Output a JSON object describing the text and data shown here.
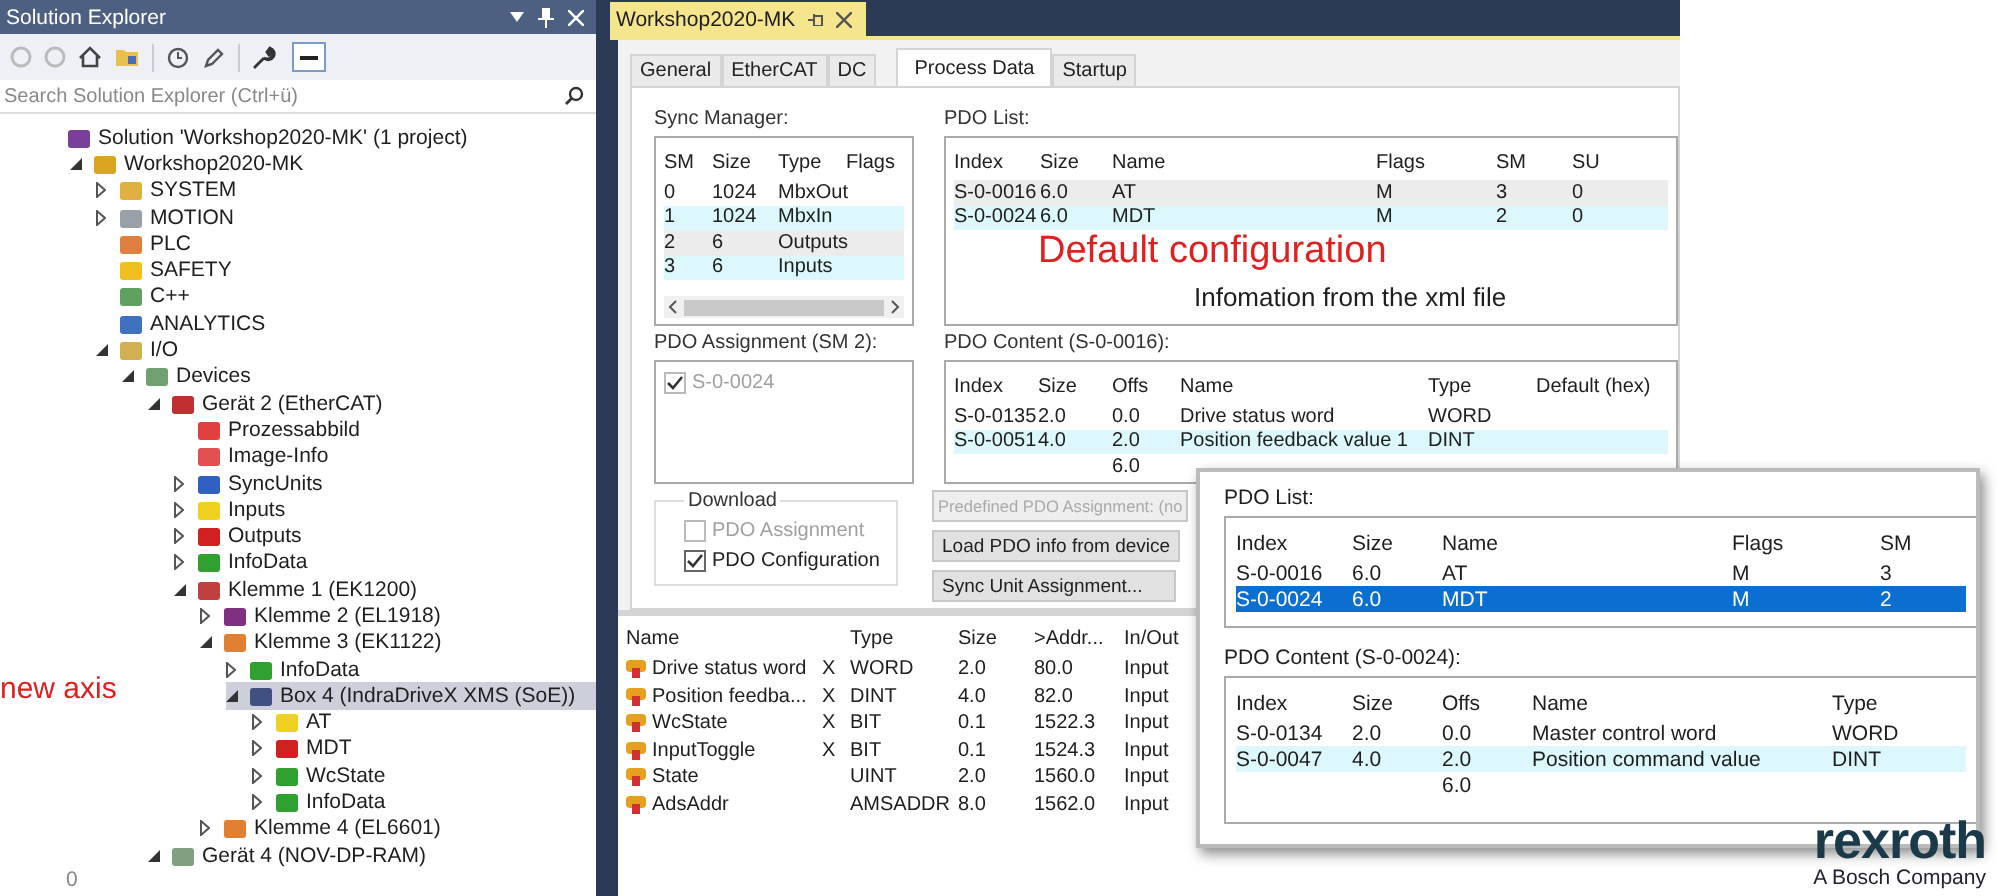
{
  "solution_explorer": {
    "title": "Solution Explorer",
    "search": {
      "placeholder": "Search Solution Explorer (Ctrl+ü)"
    },
    "tree": [
      {
        "label": "Solution 'Workshop2020-MK' (1 project)",
        "color": "#7a3f9a",
        "selected": false,
        "children": [
          {
            "label": "Workshop2020-MK",
            "color": "#d9a520",
            "expanded": true,
            "selected": false,
            "children": [
              {
                "label": "SYSTEM",
                "color": "#e0b040",
                "expanded": false,
                "selected": false
              },
              {
                "label": "MOTION",
                "color": "#9aa0a8",
                "expanded": false,
                "selected": false
              },
              {
                "label": "PLC",
                "color": "#e08040",
                "selected": false
              },
              {
                "label": "SAFETY",
                "color": "#f0c020",
                "selected": false
              },
              {
                "label": "C++",
                "color": "#60a060",
                "selected": false
              },
              {
                "label": "ANALYTICS",
                "color": "#4070c0",
                "selected": false
              },
              {
                "label": "I/O",
                "color": "#d0b050",
                "expanded": true,
                "selected": false,
                "children": [
                  {
                    "label": "Devices",
                    "color": "#70a070",
                    "expanded": true,
                    "selected": false,
                    "children": [
                      {
                        "label": "Gerät 2 (EtherCAT)",
                        "color": "#c03030",
                        "expanded": true,
                        "selected": false,
                        "children": [
                          {
                            "label": "Prozessabbild",
                            "color": "#e04040",
                            "selected": false
                          },
                          {
                            "label": "Image-Info",
                            "color": "#e05050",
                            "selected": false
                          },
                          {
                            "label": "SyncUnits",
                            "color": "#3060c0",
                            "expanded": false,
                            "selected": false
                          },
                          {
                            "label": "Inputs",
                            "color": "#f0d020",
                            "expanded": false,
                            "selected": false
                          },
                          {
                            "label": "Outputs",
                            "color": "#d02020",
                            "expanded": false,
                            "selected": false
                          },
                          {
                            "label": "InfoData",
                            "color": "#30a030",
                            "expanded": false,
                            "selected": false
                          },
                          {
                            "label": "Klemme 1 (EK1200)",
                            "color": "#c04040",
                            "expanded": true,
                            "selected": false,
                            "children": [
                              {
                                "label": "Klemme 2 (EL1918)",
                                "color": "#803080",
                                "expanded": false,
                                "selected": false
                              },
                              {
                                "label": "Klemme 3 (EK1122)",
                                "color": "#e08030",
                                "expanded": true,
                                "selected": false,
                                "children": [
                                  {
                                    "label": "InfoData",
                                    "color": "#30a030",
                                    "expanded": false,
                                    "selected": false
                                  },
                                  {
                                    "label": "Box 4 (IndraDriveX XMS (SoE))",
                                    "color": "#405080",
                                    "expanded": true,
                                    "selected": true,
                                    "children": [
                                      {
                                        "label": "AT",
                                        "color": "#f0d020",
                                        "expanded": false,
                                        "selected": false
                                      },
                                      {
                                        "label": "MDT",
                                        "color": "#d02020",
                                        "expanded": false,
                                        "selected": false
                                      },
                                      {
                                        "label": "WcState",
                                        "color": "#30a030",
                                        "expanded": false,
                                        "selected": false
                                      },
                                      {
                                        "label": "InfoData",
                                        "color": "#30a030",
                                        "expanded": false,
                                        "selected": false
                                      }
                                    ]
                                  }
                                ]
                              },
                              {
                                "label": "Klemme 4 (EL6601)",
                                "color": "#e08030",
                                "expanded": false,
                                "selected": false
                              }
                            ]
                          }
                        ]
                      },
                      {
                        "label": "Gerät 4 (NOV-DP-RAM)",
                        "color": "#80a080",
                        "expanded": true,
                        "selected": false
                      }
                    ]
                  }
                ]
              }
            ]
          }
        ]
      }
    ]
  },
  "annotation": "new axis",
  "status_bar": {
    "text": "0"
  },
  "document_tab": {
    "title": "Workshop2020-MK"
  },
  "tabs": [
    {
      "label": "General",
      "selected": false
    },
    {
      "label": "EtherCAT",
      "selected": false
    },
    {
      "label": "DC",
      "selected": false
    },
    {
      "label": "Process Data",
      "selected": true
    },
    {
      "label": "Startup",
      "selected": false
    }
  ],
  "sync_manager": {
    "label": "Sync Manager:",
    "columns": [
      "SM",
      "Size",
      "Type",
      "Flags"
    ],
    "rows": [
      {
        "sm": "0",
        "size": "1024",
        "type": "MbxOut"
      },
      {
        "sm": "1",
        "size": "1024",
        "type": "MbxIn",
        "color": "#ddf8fc"
      },
      {
        "sm": "2",
        "size": "6",
        "type": "Outputs",
        "color": "#ececec"
      },
      {
        "sm": "3",
        "size": "6",
        "type": "Inputs",
        "color": "#ddf8fc"
      }
    ]
  },
  "pdo_list": {
    "label": "PDO List:",
    "columns": [
      "Index",
      "Size",
      "Name",
      "Flags",
      "SM",
      "SU"
    ],
    "rows": [
      {
        "index": "S-0-0016",
        "size": "6.0",
        "name": "AT",
        "flags": "M",
        "sm": "3",
        "su": "0",
        "color": "#ececec"
      },
      {
        "index": "S-0-0024",
        "size": "6.0",
        "name": "MDT",
        "flags": "M",
        "sm": "2",
        "su": "0",
        "color": "#ddf8fc"
      }
    ],
    "overlay_title": "Default configuration",
    "overlay_note": "Infomation from the xml file"
  },
  "pdo_assignment": {
    "label": "PDO Assignment (SM 2):",
    "items": [
      {
        "label": "S-0-0024",
        "checked": true,
        "disabled": true
      }
    ]
  },
  "pdo_content": {
    "label": "PDO Content (S-0-0016):",
    "columns": [
      "Index",
      "Size",
      "Offs",
      "Name",
      "Type",
      "Default (hex)"
    ],
    "rows": [
      {
        "index": "S-0-0135",
        "size": "2.0",
        "offs": "0.0",
        "name": "Drive status word",
        "type": "WORD"
      },
      {
        "index": "S-0-0051",
        "size": "4.0",
        "offs": "2.0",
        "name": "Position feedback value 1",
        "type": "DINT",
        "color": "#ddf8fc"
      },
      {
        "offs": "6.0"
      }
    ]
  },
  "download": {
    "label": "Download",
    "options": [
      {
        "label": "PDO Assignment",
        "checked": false,
        "disabled": true
      },
      {
        "label": "PDO Configuration",
        "checked": true,
        "disabled": false
      }
    ]
  },
  "buttons": [
    {
      "label": "Predefined PDO Assignment: (no",
      "disabled": true
    },
    {
      "label": "Load PDO info from device",
      "disabled": false
    },
    {
      "label": "Sync Unit Assignment...",
      "disabled": false
    }
  ],
  "variables": {
    "columns": [
      "Name",
      "Type",
      "Size",
      ">Addr...",
      "In/Out"
    ],
    "rows": [
      {
        "name": "Drive status word",
        "x": "X",
        "type": "WORD",
        "size": "2.0",
        "addr": "80.0",
        "inout": "Input"
      },
      {
        "name": "Position feedba...",
        "x": "X",
        "type": "DINT",
        "size": "4.0",
        "addr": "82.0",
        "inout": "Input"
      },
      {
        "name": "WcState",
        "x": "X",
        "type": "BIT",
        "size": "0.1",
        "addr": "1522.3",
        "inout": "Input"
      },
      {
        "name": "InputToggle",
        "x": "X",
        "type": "BIT",
        "size": "0.1",
        "addr": "1524.3",
        "inout": "Input"
      },
      {
        "name": "State",
        "type": "UINT",
        "size": "2.0",
        "addr": "1560.0",
        "inout": "Input"
      },
      {
        "name": "AdsAddr",
        "type": "AMSADDR",
        "size": "8.0",
        "addr": "1562.0",
        "inout": "Input"
      }
    ]
  },
  "callout": {
    "pdo_list": {
      "label": "PDO List:",
      "columns": [
        "Index",
        "Size",
        "Name",
        "Flags",
        "SM"
      ],
      "rows": [
        {
          "index": "S-0-0016",
          "size": "6.0",
          "name": "AT",
          "flags": "M",
          "sm": "3",
          "selected": false
        },
        {
          "index": "S-0-0024",
          "size": "6.0",
          "name": "MDT",
          "flags": "M",
          "sm": "2",
          "selected": true
        }
      ]
    },
    "pdo_content": {
      "label": "PDO Content (S-0-0024):",
      "columns": [
        "Index",
        "Size",
        "Offs",
        "Name",
        "Type"
      ],
      "rows": [
        {
          "index": "S-0-0134",
          "size": "2.0",
          "offs": "0.0",
          "name": "Master control word",
          "type": "WORD"
        },
        {
          "index": "S-0-0047",
          "size": "4.0",
          "offs": "2.0",
          "name": "Position command value",
          "type": "DINT",
          "color": "#ddf8fc"
        },
        {
          "offs": "6.0"
        }
      ]
    }
  },
  "logo": {
    "name": "rexroth",
    "tagline": "A Bosch Company"
  }
}
